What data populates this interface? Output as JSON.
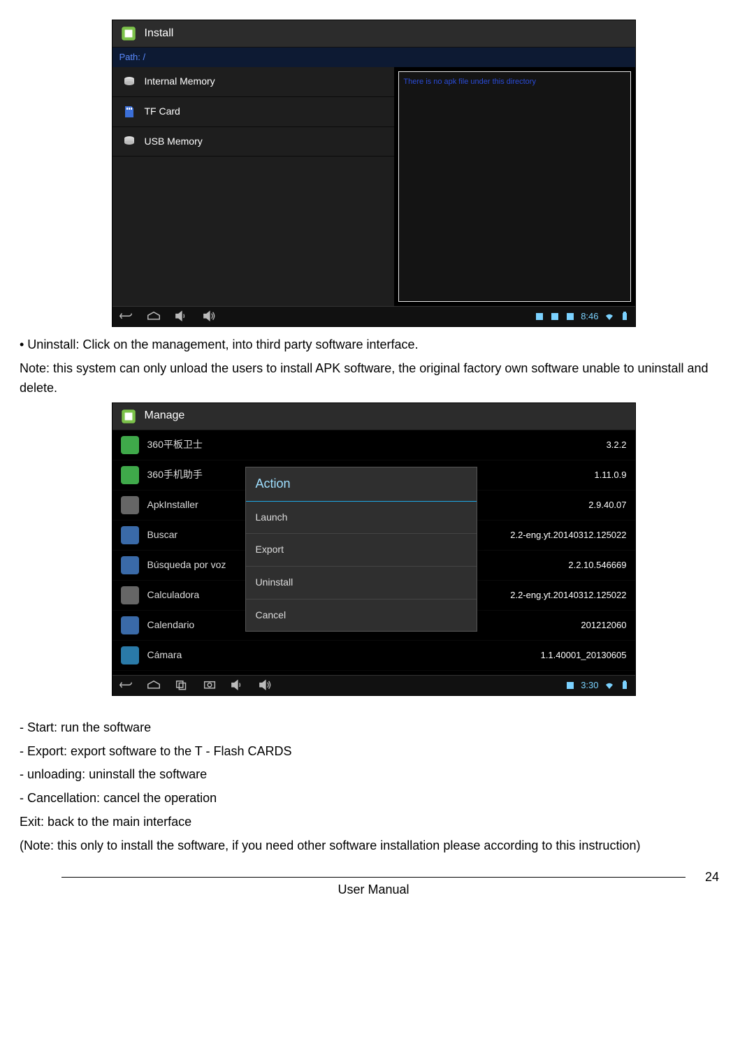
{
  "screenshot1": {
    "title": "Install",
    "path_label": "Path: /",
    "storage": [
      {
        "label": "Internal Memory",
        "icon": "disk-icon"
      },
      {
        "label": "TF Card",
        "icon": "sd-card-icon"
      },
      {
        "label": "USB Memory",
        "icon": "disk-icon"
      }
    ],
    "right_hint": "There is no apk file under this directory",
    "statusbar": {
      "time": "8:46"
    }
  },
  "text": {
    "p1": "• Uninstall: Click on the management, into third party software interface.",
    "p2": "Note: this system can only unload the users to install APK software, the original factory own software unable to uninstall and delete."
  },
  "screenshot2": {
    "title": "Manage",
    "apps": [
      {
        "name": "360平板卫士",
        "version": "3.2.2",
        "icon_bg": "#3fa94a"
      },
      {
        "name": "360手机助手",
        "version": "1.11.0.9",
        "icon_bg": "#3fa94a"
      },
      {
        "name": "ApkInstaller",
        "version": "2.9.40.07",
        "icon_bg": "#666"
      },
      {
        "name": "Buscar",
        "version": "2.2-eng.yt.20140312.125022",
        "icon_bg": "#3a6aa8"
      },
      {
        "name": "Búsqueda por voz",
        "version": "2.2.10.546669",
        "icon_bg": "#3a6aa8"
      },
      {
        "name": "Calculadora",
        "version": "2.2-eng.yt.20140312.125022",
        "icon_bg": "#666"
      },
      {
        "name": "Calendario",
        "version": "201212060",
        "icon_bg": "#3a6aa8"
      },
      {
        "name": "Cámara",
        "version": "1.1.40001_20130605",
        "icon_bg": "#2a7aa8"
      }
    ],
    "dialog": {
      "title": "Action",
      "options": [
        "Launch",
        "Export",
        "Uninstall",
        "Cancel"
      ]
    },
    "statusbar": {
      "time": "3:30"
    }
  },
  "after": {
    "l1": "- Start: run the software",
    "l2": "- Export: export software to the T - Flash CARDS",
    "l3": "- unloading: uninstall the software",
    "l4": "- Cancellation: cancel the operation",
    "l5": "Exit: back to the main interface",
    "l6": "(Note: this only to install the software, if you need other software installation please according to this instruction)"
  },
  "footer": {
    "label": "User Manual",
    "page": "24"
  }
}
